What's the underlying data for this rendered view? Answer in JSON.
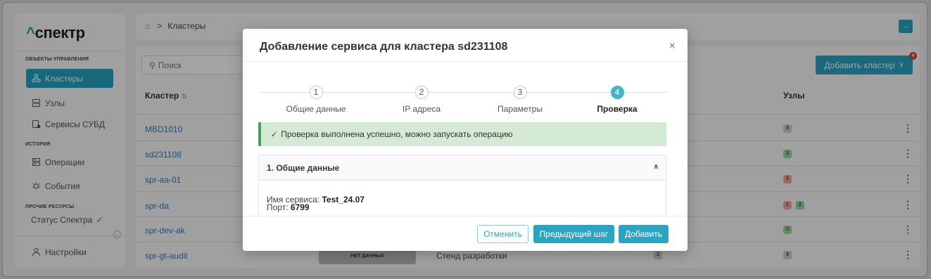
{
  "sidebar": {
    "logo_caret": "^",
    "logo_text": "спектр",
    "section_objects": "ОБЪЕКТЫ УПРАВЛЕНИЯ",
    "section_history": "ИСТОРИЯ",
    "section_other": "ПРОЧИЕ РЕСУРСЫ",
    "items": [
      {
        "label": "Кластеры",
        "icon": "cluster-icon"
      },
      {
        "label": "Узлы",
        "icon": "server-icon"
      },
      {
        "label": "Сервисы СУБД",
        "icon": "database-service-icon"
      },
      {
        "label": "Операции",
        "icon": "operations-icon"
      },
      {
        "label": "События",
        "icon": "events-icon"
      }
    ],
    "status_label": "Статус Спектра",
    "settings_label": "Настройки",
    "accent": "#24a3c2"
  },
  "topbar": {
    "home_icon": "home-icon",
    "separator": ">",
    "breadcrumb": "Кластеры"
  },
  "main": {
    "search_placeholder": "Поиск",
    "add_cluster_label": "Добавить кластер",
    "notification_count": "4",
    "col_cluster": "Кластер",
    "col_nodes": "Узлы",
    "rows": [
      {
        "name": "MBD1010",
        "nodes": [
          {
            "n": "3",
            "c": "grey"
          }
        ]
      },
      {
        "name": "sd231108",
        "nodes": [
          {
            "n": "3",
            "c": "green"
          }
        ]
      },
      {
        "name": "spr-aa-01",
        "nodes": [
          {
            "n": "3",
            "c": "red"
          }
        ]
      },
      {
        "name": "spr-da",
        "nodes": [
          {
            "n": "1",
            "c": "red"
          },
          {
            "n": "2",
            "c": "green"
          }
        ]
      },
      {
        "name": "spr-dev-ak",
        "nodes": [
          {
            "n": "3",
            "c": "green"
          }
        ]
      },
      {
        "name": "spr-gt-audit",
        "nodes": [
          {
            "n": "3",
            "c": "grey"
          }
        ]
      }
    ],
    "last_row_status": "НЕТ ДАННЫХ",
    "last_row_env": "Стенд разработки",
    "last_row_count": "1"
  },
  "modal": {
    "title": "Добавление сервиса для кластера sd231108",
    "close": "×",
    "steps": [
      {
        "num": "1",
        "label": "Общие данные"
      },
      {
        "num": "2",
        "label": "IP адреса"
      },
      {
        "num": "3",
        "label": "Параметры"
      },
      {
        "num": "4",
        "label": "Проверка"
      }
    ],
    "active_step": 4,
    "alert_text": "Проверка выполнена успешно, можно запускать операцию",
    "section_title": "1. Общие данные",
    "service_name_label": "Имя сервиса:",
    "service_name_value": "Test_24.07",
    "port_label": "Порт:",
    "port_value": "6799",
    "btn_cancel": "Отменить",
    "btn_prev": "Предыдущий шаг",
    "btn_add": "Добавить"
  }
}
